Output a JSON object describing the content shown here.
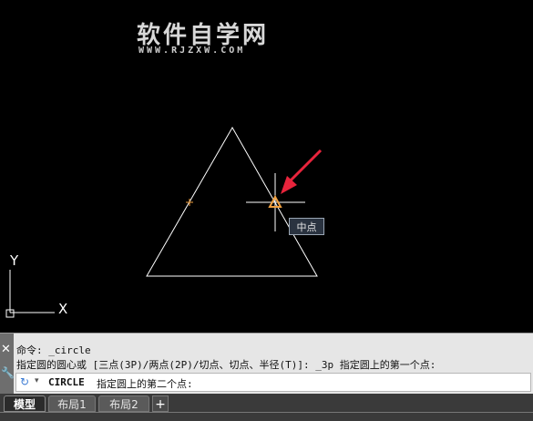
{
  "watermark": {
    "title": "软件自学网",
    "url": "WWW.RJZXW.COM"
  },
  "canvas": {
    "tooltip": "中点",
    "ucs": {
      "x_label": "X",
      "y_label": "Y"
    }
  },
  "command": {
    "history": [
      "命令: _circle",
      "指定圆的圆心或 [三点(3P)/两点(2P)/切点、切点、半径(T)]: _3p 指定圆上的第一个点:"
    ],
    "current_command": "CIRCLE",
    "current_prompt": "指定圆上的第二个点:"
  },
  "tabs": [
    {
      "label": "模型",
      "active": true
    },
    {
      "label": "布局1",
      "active": false
    },
    {
      "label": "布局2",
      "active": false
    }
  ],
  "colors": {
    "background": "#000000",
    "geometry": "#ffffff",
    "osnap_marker": "#f0a040",
    "arrow": "#e8243c"
  }
}
